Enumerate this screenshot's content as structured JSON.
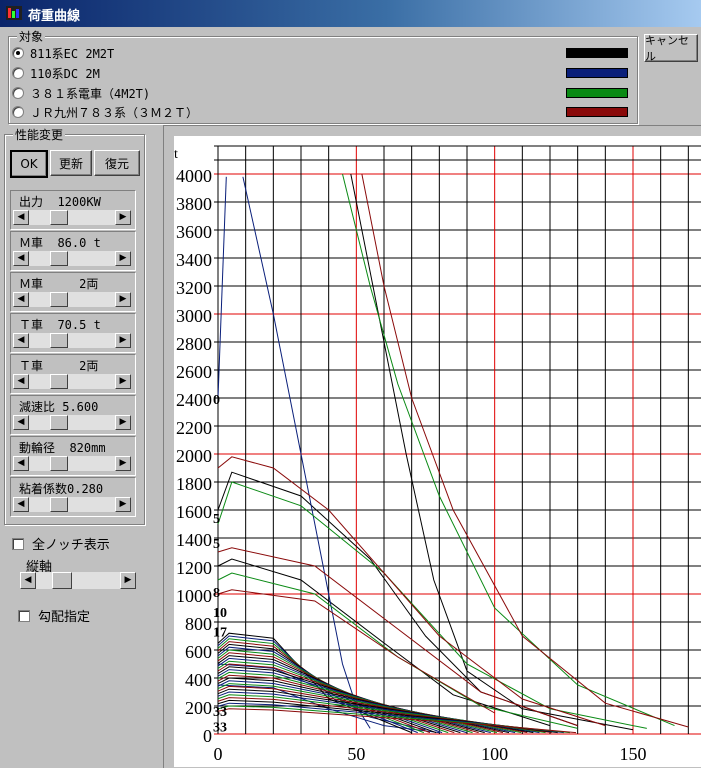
{
  "window": {
    "title": "荷重曲線"
  },
  "target_group": {
    "title": "対象",
    "items": [
      {
        "label": "811系EC  2M2T",
        "checked": true,
        "color": "#000000"
      },
      {
        "label": "110系DC 2M",
        "checked": false,
        "color": "#0a1f7a"
      },
      {
        "label": "３８１系電車（4M2T)",
        "checked": false,
        "color": "#0a8a14"
      },
      {
        "label": "ＪＲ九州７８３系（３Ｍ２Ｔ）",
        "checked": false,
        "color": "#8a0a0a"
      }
    ]
  },
  "cancel_label": "キャンセル",
  "perf_group": {
    "title": "性能変更",
    "ok_label": "OK",
    "update_label": "更新",
    "restore_label": "復元",
    "params": [
      {
        "label": "出力  1200KW",
        "level": 0.3
      },
      {
        "label": "Ｍ車  86.0 t",
        "level": 0.3
      },
      {
        "label": "Ｍ車     2両",
        "level": 0.3
      },
      {
        "label": "Ｔ車  70.5 t",
        "level": 0.3
      },
      {
        "label": "Ｔ車     2両",
        "level": 0.3
      },
      {
        "label": "減速比 5.600",
        "level": 0.3
      },
      {
        "label": "動輪径  820mm",
        "level": 0.3
      },
      {
        "label": "粘着係数0.280",
        "level": 0.3
      }
    ]
  },
  "all_notch_label": "全ノッチ表示",
  "vaxis_label": "縦軸",
  "vaxis_level": 0.25,
  "gradient_label": "勾配指定",
  "chart_data": {
    "type": "line",
    "ylabel": "t",
    "xlim": [
      0,
      175
    ],
    "ylim": [
      0,
      4000
    ],
    "x_ticks": [
      "0",
      "50",
      "100",
      "150"
    ],
    "y_ticks": [
      "0",
      "200",
      "400",
      "600",
      "800",
      "1000",
      "1200",
      "1400",
      "1600",
      "1800",
      "2000",
      "2200",
      "2400",
      "2600",
      "2800",
      "3000",
      "3200",
      "3400",
      "3600",
      "3800",
      "4000"
    ],
    "notch_labels": [
      {
        "text": "0",
        "y": 2400
      },
      {
        "text": "5",
        "y": 1550
      },
      {
        "text": "5",
        "y": 1370
      },
      {
        "text": "8",
        "y": 1020
      },
      {
        "text": "10",
        "y": 880
      },
      {
        "text": "17",
        "y": 740
      },
      {
        "text": "33",
        "y": 170
      },
      {
        "text": "33",
        "y": 60
      }
    ],
    "series": [
      {
        "color": "#000000",
        "points": [
          [
            48,
            4000
          ],
          [
            58,
            3000
          ],
          [
            68,
            2000
          ],
          [
            78,
            1100
          ],
          [
            90,
            450
          ],
          [
            110,
            180
          ],
          [
            150,
            30
          ]
        ]
      },
      {
        "color": "#000000",
        "points": [
          [
            0,
            1600
          ],
          [
            5,
            1870
          ],
          [
            30,
            1700
          ],
          [
            55,
            1250
          ],
          [
            75,
            700
          ],
          [
            95,
            300
          ],
          [
            130,
            60
          ]
        ]
      },
      {
        "color": "#000000",
        "points": [
          [
            0,
            1200
          ],
          [
            5,
            1250
          ],
          [
            30,
            1100
          ],
          [
            60,
            650
          ],
          [
            85,
            280
          ],
          [
            120,
            60
          ]
        ]
      },
      {
        "color": "#0a1f7a",
        "points": [
          [
            0,
            2400
          ],
          [
            3,
            3980
          ]
        ]
      },
      {
        "color": "#0a1f7a",
        "points": [
          [
            9,
            3980
          ],
          [
            20,
            3000
          ],
          [
            30,
            2000
          ],
          [
            38,
            1200
          ],
          [
            45,
            500
          ],
          [
            50,
            200
          ],
          [
            55,
            40
          ]
        ]
      },
      {
        "color": "#0a1f7a",
        "points": [
          [
            0,
            500
          ],
          [
            20,
            470
          ],
          [
            40,
            300
          ],
          [
            55,
            120
          ],
          [
            75,
            30
          ]
        ]
      },
      {
        "color": "#0a1f7a",
        "points": [
          [
            0,
            350
          ],
          [
            20,
            330
          ],
          [
            40,
            180
          ],
          [
            60,
            60
          ],
          [
            80,
            10
          ]
        ]
      },
      {
        "color": "#0a8a14",
        "points": [
          [
            45,
            4000
          ],
          [
            55,
            3200
          ],
          [
            65,
            2500
          ],
          [
            80,
            1700
          ],
          [
            100,
            900
          ],
          [
            130,
            350
          ],
          [
            165,
            60
          ]
        ]
      },
      {
        "color": "#0a8a14",
        "points": [
          [
            0,
            1500
          ],
          [
            5,
            1800
          ],
          [
            30,
            1630
          ],
          [
            60,
            1150
          ],
          [
            90,
            500
          ],
          [
            120,
            180
          ],
          [
            155,
            40
          ]
        ]
      },
      {
        "color": "#0a8a14",
        "points": [
          [
            0,
            1100
          ],
          [
            5,
            1150
          ],
          [
            35,
            1000
          ],
          [
            65,
            550
          ],
          [
            95,
            200
          ],
          [
            130,
            40
          ]
        ]
      },
      {
        "color": "#8a0a0a",
        "points": [
          [
            52,
            4000
          ],
          [
            60,
            3200
          ],
          [
            70,
            2400
          ],
          [
            85,
            1600
          ],
          [
            110,
            700
          ],
          [
            140,
            220
          ],
          [
            170,
            50
          ]
        ]
      },
      {
        "color": "#8a0a0a",
        "points": [
          [
            0,
            1900
          ],
          [
            5,
            1980
          ],
          [
            20,
            1900
          ],
          [
            40,
            1600
          ],
          [
            60,
            1150
          ],
          [
            80,
            700
          ],
          [
            110,
            250
          ],
          [
            140,
            60
          ]
        ]
      },
      {
        "color": "#8a0a0a",
        "points": [
          [
            0,
            1300
          ],
          [
            5,
            1330
          ],
          [
            35,
            1200
          ],
          [
            65,
            750
          ],
          [
            95,
            300
          ],
          [
            130,
            60
          ]
        ]
      },
      {
        "color": "#8a0a0a",
        "points": [
          [
            0,
            1000
          ],
          [
            5,
            1030
          ],
          [
            35,
            950
          ],
          [
            65,
            550
          ],
          [
            100,
            150
          ]
        ]
      }
    ]
  }
}
